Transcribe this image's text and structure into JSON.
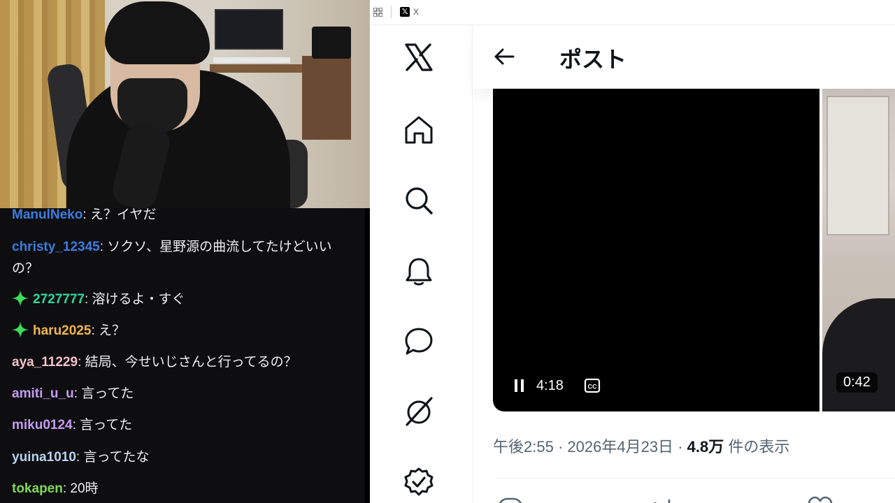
{
  "chat": {
    "messages": [
      {
        "user": "ManulNeko",
        "color": "#3b7de0",
        "badge": false,
        "text": "え？イヤだ"
      },
      {
        "user": "christy_12345",
        "color": "#3b7de0",
        "badge": false,
        "text": "ソクソ、星野源の曲流してたけどいいの？"
      },
      {
        "user": "2727777",
        "color": "#2ed8a0",
        "badge": true,
        "text": "溶けるよ・すぐ"
      },
      {
        "user": "haru2025",
        "color": "#f2b64b",
        "badge": true,
        "text": "え？"
      },
      {
        "user": "aya_11229",
        "color": "#f3c1c9",
        "badge": false,
        "text": "結局、今せいじさんと行ってるの？"
      },
      {
        "user": "amiti_u_u",
        "color": "#c59bf2",
        "badge": false,
        "text": "言ってた"
      },
      {
        "user": "miku0124",
        "color": "#c59bf2",
        "badge": false,
        "text": "言ってた"
      },
      {
        "user": "yuina1010",
        "color": "#b7d3f0",
        "badge": false,
        "text": "言ってたな"
      },
      {
        "user": "tokapen",
        "color": "#7ed957",
        "badge": false,
        "text": "20時"
      }
    ]
  },
  "browser": {
    "tab_title": "X",
    "header_title": "ポスト",
    "video_time": "4:18",
    "second_video_duration": "0:42",
    "meta": {
      "time": "午後2:55",
      "dot": "·",
      "date": "2026年4月23日",
      "views": "4.8万",
      "views_label": "件の表示"
    }
  },
  "nav": {
    "icons": [
      "x-logo-icon",
      "home-icon",
      "search-icon",
      "notifications-icon",
      "messages-icon",
      "grok-icon",
      "verified-icon"
    ]
  }
}
